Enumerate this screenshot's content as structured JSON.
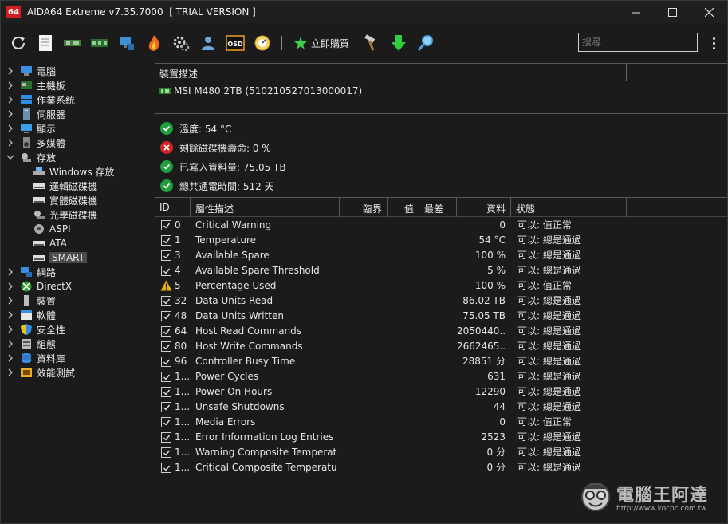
{
  "window": {
    "logo": "64",
    "title": "AIDA64 Extreme v7.35.7000  [ TRIAL VERSION ]",
    "controls": [
      "minimize",
      "maximize",
      "close"
    ]
  },
  "toolbar": {
    "icons": [
      "refresh-icon",
      "report-icon",
      "motherboard-icon",
      "memory-icon",
      "network-icon",
      "flame-icon",
      "gears-icon",
      "user-icon",
      "osd-icon",
      "gauge-icon"
    ],
    "buy_label": "立即購買",
    "search_placeholder": "搜尋"
  },
  "tree": {
    "items": [
      {
        "label": "電腦",
        "icon": "computer-icon",
        "expandable": true
      },
      {
        "label": "主機板",
        "icon": "motherboard-icon",
        "expandable": true
      },
      {
        "label": "作業系統",
        "icon": "windows-icon",
        "expandable": true
      },
      {
        "label": "伺服器",
        "icon": "server-icon",
        "expandable": true
      },
      {
        "label": "顯示",
        "icon": "display-icon",
        "expandable": true
      },
      {
        "label": "多媒體",
        "icon": "speaker-icon",
        "expandable": true
      },
      {
        "label": "存放",
        "icon": "storage-icon",
        "expandable": true,
        "expanded": true
      },
      {
        "label": "Windows 存放",
        "icon": "windows-storage-icon",
        "child": true
      },
      {
        "label": "邏輯磁碟機",
        "icon": "logical-drive-icon",
        "child": true
      },
      {
        "label": "實體磁碟機",
        "icon": "physical-drive-icon",
        "child": true
      },
      {
        "label": "光學磁碟機",
        "icon": "optical-drive-icon",
        "child": true
      },
      {
        "label": "ASPI",
        "icon": "aspi-icon",
        "child": true
      },
      {
        "label": "ATA",
        "icon": "ata-icon",
        "child": true
      },
      {
        "label": "SMART",
        "icon": "smart-icon",
        "child": true,
        "selected": true
      },
      {
        "label": "網路",
        "icon": "network-icon",
        "expandable": true
      },
      {
        "label": "DirectX",
        "icon": "xbox-icon",
        "expandable": true
      },
      {
        "label": "裝置",
        "icon": "device-icon",
        "expandable": true
      },
      {
        "label": "軟體",
        "icon": "software-icon",
        "expandable": true
      },
      {
        "label": "安全性",
        "icon": "shield-icon",
        "expandable": true
      },
      {
        "label": "組態",
        "icon": "config-icon",
        "expandable": true
      },
      {
        "label": "資料庫",
        "icon": "database-icon",
        "expandable": true
      },
      {
        "label": "效能測試",
        "icon": "benchmark-icon",
        "expandable": true
      }
    ]
  },
  "device": {
    "header": "裝置描述",
    "name": "MSI M480 2TB (510210527013000017)"
  },
  "status": [
    {
      "label": "溫度: 54 °C",
      "state": "ok"
    },
    {
      "label": "剩餘磁碟機壽命: 0 %",
      "state": "bad"
    },
    {
      "label": "已寫入資料量: 75.05 TB",
      "state": "ok"
    },
    {
      "label": "總共通電時間: 512 天",
      "state": "ok"
    }
  ],
  "table": {
    "headers": {
      "id": "ID",
      "attr": "屬性描述",
      "threshold": "臨界",
      "value": "值",
      "worst": "最差",
      "data": "資料",
      "status": "狀態"
    },
    "rows": [
      {
        "id": "0",
        "attr": "Critical Warning",
        "data": "0",
        "status": "可以: 值正常",
        "flag": "check"
      },
      {
        "id": "1",
        "attr": "Temperature",
        "data": "54 °C",
        "status": "可以: 總是通過",
        "flag": "check"
      },
      {
        "id": "3",
        "attr": "Available Spare",
        "data": "100 %",
        "status": "可以: 總是通過",
        "flag": "check"
      },
      {
        "id": "4",
        "attr": "Available Spare Threshold",
        "data": "5 %",
        "status": "可以: 總是通過",
        "flag": "check"
      },
      {
        "id": "5",
        "attr": "Percentage Used",
        "data": "100 %",
        "status": "可以: 值正常",
        "flag": "warn"
      },
      {
        "id": "32",
        "attr": "Data Units Read",
        "data": "86.02 TB",
        "status": "可以: 總是通過",
        "flag": "check"
      },
      {
        "id": "48",
        "attr": "Data Units Written",
        "data": "75.05 TB",
        "status": "可以: 總是通過",
        "flag": "check"
      },
      {
        "id": "64",
        "attr": "Host Read Commands",
        "data": "2050440...",
        "status": "可以: 總是通過",
        "flag": "check"
      },
      {
        "id": "80",
        "attr": "Host Write Commands",
        "data": "2662465...",
        "status": "可以: 總是通過",
        "flag": "check"
      },
      {
        "id": "96",
        "attr": "Controller Busy Time",
        "data": "28851 分",
        "status": "可以: 總是通過",
        "flag": "check"
      },
      {
        "id": "1...",
        "attr": "Power Cycles",
        "data": "631",
        "status": "可以: 總是通過",
        "flag": "check"
      },
      {
        "id": "1...",
        "attr": "Power-On Hours",
        "data": "12290",
        "status": "可以: 總是通過",
        "flag": "check"
      },
      {
        "id": "1...",
        "attr": "Unsafe Shutdowns",
        "data": "44",
        "status": "可以: 總是通過",
        "flag": "check"
      },
      {
        "id": "1...",
        "attr": "Media Errors",
        "data": "0",
        "status": "可以: 值正常",
        "flag": "check"
      },
      {
        "id": "1...",
        "attr": "Error Information Log Entries",
        "data": "2523",
        "status": "可以: 總是通過",
        "flag": "check"
      },
      {
        "id": "1...",
        "attr": "Warning Composite Temperat...",
        "data": "0 分",
        "status": "可以: 總是通過",
        "flag": "check"
      },
      {
        "id": "1...",
        "attr": "Critical Composite Temperatur...",
        "data": "0 分",
        "status": "可以: 總是通過",
        "flag": "check"
      }
    ]
  },
  "watermark": {
    "text": "電腦王阿達",
    "url": "http://www.kocpc.com.tw"
  },
  "colors": {
    "ok": "#1e9e3c",
    "bad": "#d22424",
    "warn": "#f0b400",
    "green_arrow": "#2fcf3f",
    "brand_red": "#d21e1e"
  }
}
